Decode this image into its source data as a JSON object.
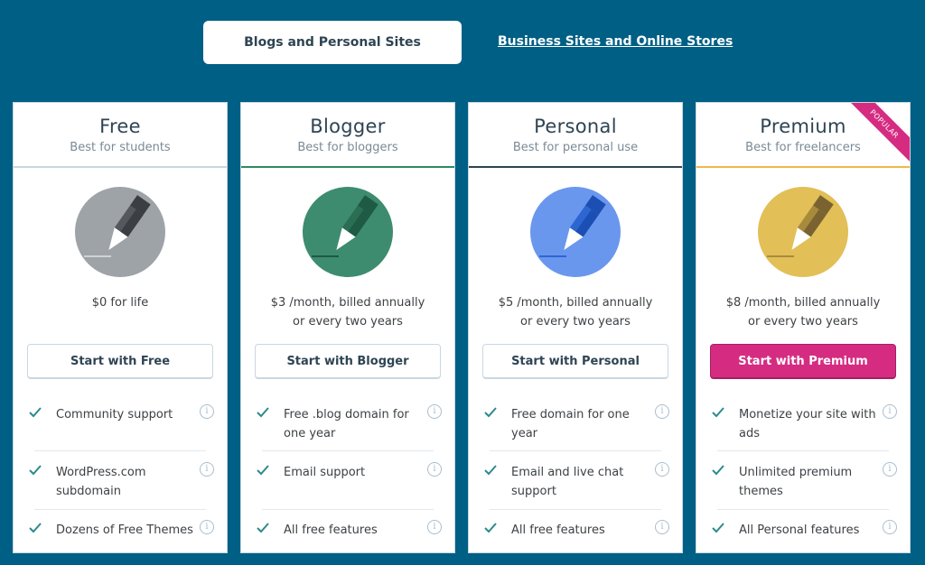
{
  "tabs": {
    "active": "Blogs and Personal Sites",
    "other": "Business Sites and Online Stores"
  },
  "colors": {
    "background": "#005f85",
    "free_accent": "#c8d7e1",
    "blogger_accent": "#2e8a5c",
    "personal_accent": "#2e4453",
    "premium_accent": "#f0b849",
    "primary_button": "#d52c82",
    "check": "#2e8a8a"
  },
  "plans": [
    {
      "name": "Free",
      "tagline": "Best for students",
      "price_line1": "$0 for life",
      "price_line2": "",
      "cta": "Start with Free",
      "icon": "pencil-gray-icon",
      "features": [
        "Community support",
        "WordPress.com subdomain",
        "Dozens of Free Themes"
      ]
    },
    {
      "name": "Blogger",
      "tagline": "Best for bloggers",
      "price_line1": "$3 /month, billed annually",
      "price_line2": "or every two years",
      "cta": "Start with Blogger",
      "icon": "pencil-green-icon",
      "features": [
        "Free .blog domain for one year",
        "Email support",
        "All free features"
      ]
    },
    {
      "name": "Personal",
      "tagline": "Best for personal use",
      "price_line1": "$5 /month, billed annually",
      "price_line2": "or every two years",
      "cta": "Start with Personal",
      "icon": "pencil-blue-icon",
      "features": [
        "Free domain for one year",
        "Email and live chat support",
        "All free features"
      ]
    },
    {
      "name": "Premium",
      "tagline": "Best for freelancers",
      "price_line1": "$8 /month, billed annually",
      "price_line2": "or every two years",
      "cta": "Start with Premium",
      "icon": "pencil-yellow-icon",
      "badge": "POPULAR",
      "features": [
        "Monetize your site with ads",
        "Unlimited premium themes",
        "All Personal features"
      ]
    }
  ]
}
